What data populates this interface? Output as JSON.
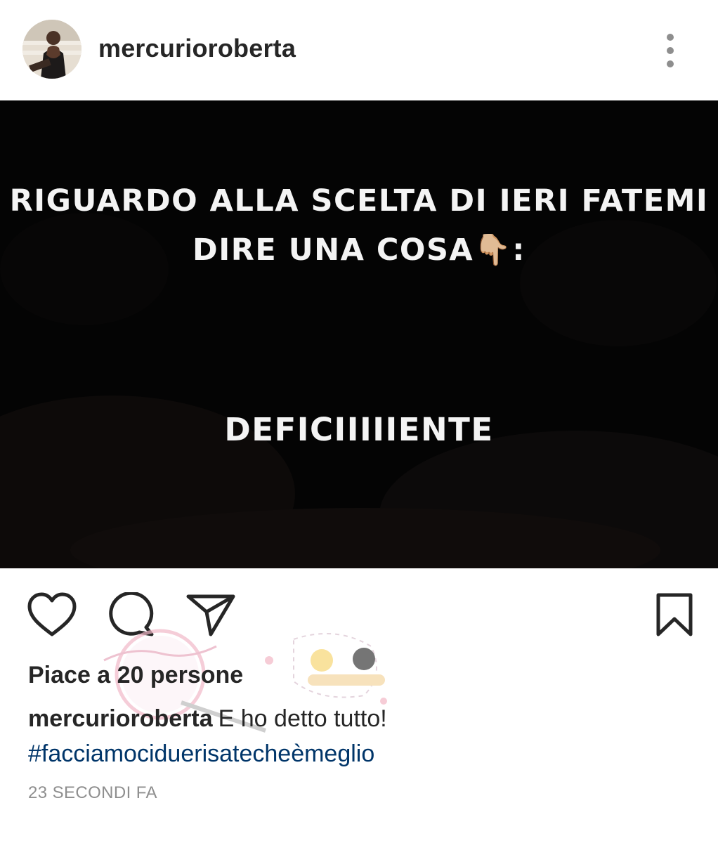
{
  "post": {
    "username": "mercurioroberta",
    "image_text": {
      "line1": "RIGUARDO ALLA SCELTA DI IERI FATEMI",
      "line2": "DIRE UNA COSA👇🏼:",
      "line3": "DEFICIIIIIENTE"
    },
    "likes_text": "Piace a 20 persone",
    "caption_user": "mercurioroberta",
    "caption_text": "E ho detto tutto!",
    "hashtag": "#facciamociduerisatecheèmeglio",
    "timestamp": "23 SECONDI FA"
  },
  "icons": {
    "more": "more-vertical-icon",
    "like": "heart-icon",
    "comment": "comment-icon",
    "share": "send-icon",
    "save": "bookmark-icon"
  },
  "colors": {
    "text": "#262626",
    "hashtag": "#003569",
    "timestamp": "#8e8e8e",
    "image_bg": "#040404"
  }
}
